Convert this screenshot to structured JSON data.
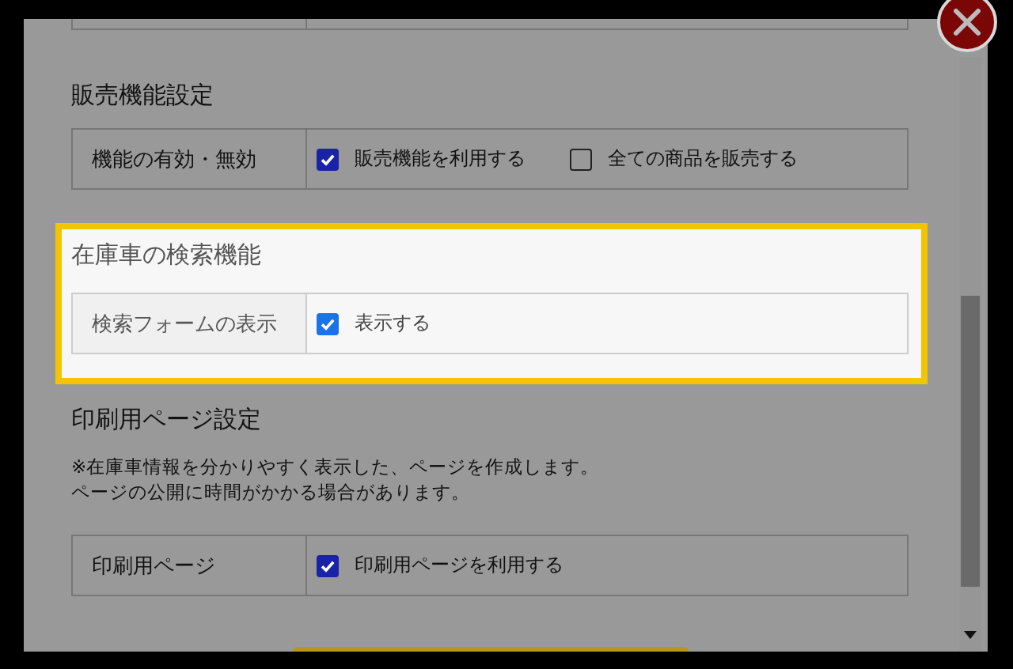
{
  "sections": [
    {
      "heading": "販売機能設定",
      "highlighted": false,
      "rows": [
        {
          "label": "機能の有効・無効",
          "options": [
            {
              "text": "販売機能を利用する",
              "checked": true
            },
            {
              "text": "全ての商品を販売する",
              "checked": false
            }
          ]
        }
      ]
    },
    {
      "heading": "在庫車の検索機能",
      "highlighted": true,
      "rows": [
        {
          "label": "検索フォームの表示",
          "options": [
            {
              "text": "表示する",
              "checked": true
            }
          ]
        }
      ]
    },
    {
      "heading": "印刷用ページ設定",
      "highlighted": false,
      "notes": [
        "※在庫車情報を分かりやすく表示した、ページを作成します。",
        "ページの公開に時間がかかる場合があります。"
      ],
      "rows": [
        {
          "label": "印刷用ページ",
          "options": [
            {
              "text": "印刷用ページを利用する",
              "checked": true
            }
          ]
        }
      ]
    }
  ]
}
